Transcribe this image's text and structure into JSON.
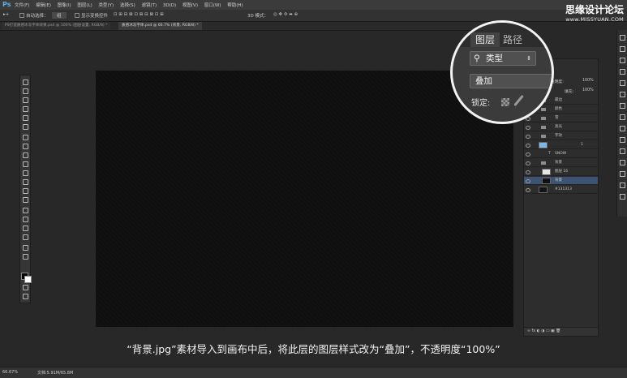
{
  "app": {
    "logo": "Ps"
  },
  "menu": [
    "文件(F)",
    "编辑(E)",
    "图像(I)",
    "图层(L)",
    "类型(Y)",
    "选择(S)",
    "滤镜(T)",
    "3D(D)",
    "视图(V)",
    "窗口(W)",
    "帮助(H)"
  ],
  "options": {
    "auto_select": "自动选择：",
    "auto_select_value": "组",
    "show_transform": "显示变换控件",
    "mode_3d": "3D 模式："
  },
  "watermark": {
    "title": "思缘设计论坛",
    "url": "www.MISSYUAN.COM"
  },
  "tabs": [
    {
      "label": "PS打造质感冰冻字体效果.psd @ 100% (图层设置, RGB/8) *"
    },
    {
      "label": "质感冰冻字体.psd @ 66.7% (背景, RGB/8) *"
    }
  ],
  "magnifier": {
    "tab_layers": "图层",
    "tab_paths": "路径",
    "filter_label": "类型",
    "blend_mode": "叠加",
    "lock_label": "锁定:"
  },
  "layers_panel": {
    "opacity_label": "不透明度:",
    "opacity_value": "100%",
    "fill_label": "填充:",
    "fill_value": "100%",
    "rows": [
      {
        "name": "最边"
      },
      {
        "name": "颜色"
      },
      {
        "name": "雪"
      },
      {
        "name": "高光"
      },
      {
        "name": "字效"
      },
      {
        "name": "1"
      },
      {
        "name": "SNOW"
      },
      {
        "name": "背景"
      },
      {
        "name": "图层 16"
      },
      {
        "name": "背景"
      },
      {
        "name": "#131313"
      }
    ]
  },
  "status": {
    "zoom": "66.67%",
    "doc": "文档:5.91M/65.8M"
  },
  "caption": "“背景.jpg”素材导入到画布中后，将此层的图层样式改为“叠加”，不透明度“100%”"
}
